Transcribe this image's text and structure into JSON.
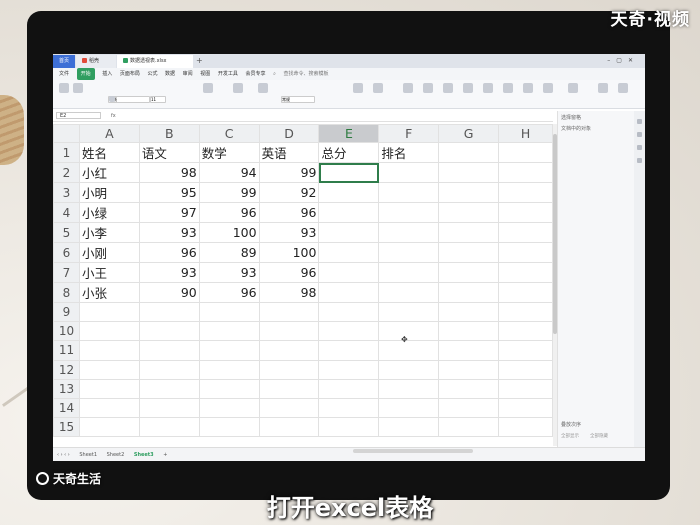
{
  "watermark_top": "天奇·视频",
  "watermark_bottom": "天奇生活",
  "caption": "打开excel表格",
  "app": {
    "tabs": [
      "首页",
      "稻壳",
      "数据透视表.xlsx"
    ],
    "menu": [
      "文件",
      "开始",
      "插入",
      "页面布局",
      "公式",
      "数据",
      "审阅",
      "视图",
      "开发工具",
      "会员专享"
    ],
    "active_menu": "开始",
    "search_placeholder": "查找命令、搜索模板",
    "font_name": "等线",
    "font_size": "11",
    "number_format": "常规",
    "name_box": "E2",
    "fx_label": "fx"
  },
  "sheet": {
    "columns": [
      "A",
      "B",
      "C",
      "D",
      "E",
      "F",
      "G",
      "H"
    ],
    "selected_column": "E",
    "selected_row": 2,
    "row_numbers": [
      1,
      2,
      3,
      4,
      5,
      6,
      7,
      8,
      9,
      10,
      11,
      12,
      13,
      14,
      15
    ],
    "header": [
      "姓名",
      "语文",
      "数学",
      "英语",
      "总分",
      "排名"
    ],
    "rows": [
      [
        "小红",
        98,
        94,
        99
      ],
      [
        "小明",
        95,
        99,
        92
      ],
      [
        "小绿",
        97,
        96,
        96
      ],
      [
        "小李",
        93,
        100,
        93
      ],
      [
        "小刚",
        96,
        89,
        100
      ],
      [
        "小王",
        93,
        93,
        96
      ],
      [
        "小张",
        90,
        96,
        98
      ]
    ],
    "sheet_tabs": [
      "Sheet1",
      "Sheet2",
      "Sheet3"
    ],
    "active_sheet": "Sheet3"
  },
  "side_panel": {
    "title": "选择窗格",
    "subtitle": "文档中的对象",
    "bottom": "叠放次序",
    "show_all": "全部显示",
    "hide_all": "全部隐藏"
  },
  "colors": {
    "accent": "#2f9e60",
    "home_tab": "#3d6fd6",
    "selection": "#2f7d4b"
  }
}
